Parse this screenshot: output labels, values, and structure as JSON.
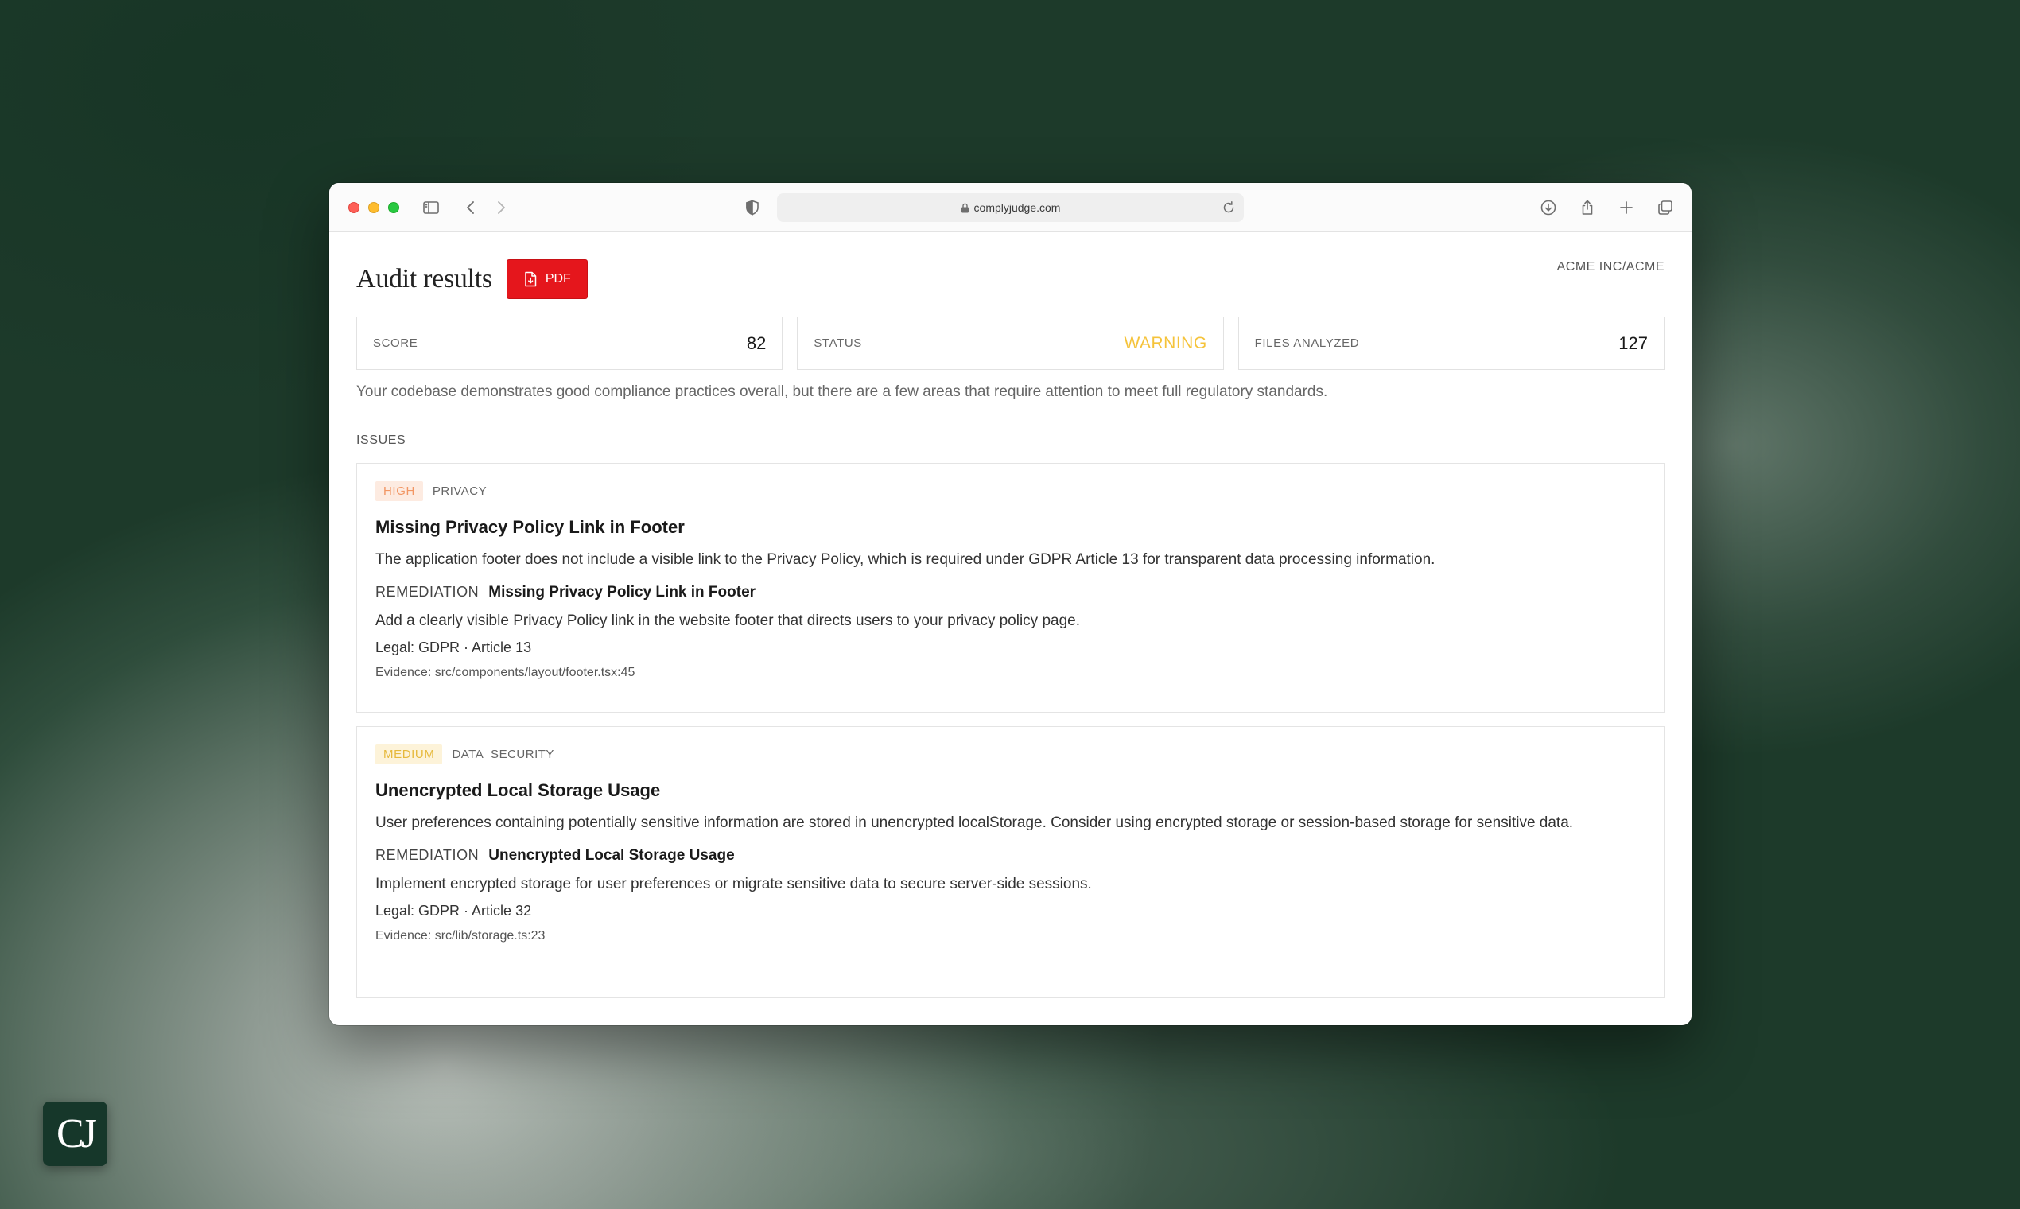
{
  "browser": {
    "url": "complyjudge.com"
  },
  "header": {
    "title": "Audit results",
    "pdf_label": "PDF",
    "org": "ACME INC/ACME"
  },
  "stats": [
    {
      "label": "SCORE",
      "value": "82"
    },
    {
      "label": "STATUS",
      "value": "WARNING"
    },
    {
      "label": "FILES ANALYZED",
      "value": "127"
    }
  ],
  "summary": "Your codebase demonstrates good compliance practices overall, but there are a few areas that require attention to meet full regulatory standards.",
  "issues_label": "ISSUES",
  "issues": [
    {
      "severity": "HIGH",
      "category": "PRIVACY",
      "title": "Missing Privacy Policy Link in Footer",
      "description": "The application footer does not include a visible link to the Privacy Policy, which is required under GDPR Article 13 for transparent data processing information.",
      "remediation_label": "REMEDIATION",
      "remediation_title": "Missing Privacy Policy Link in Footer",
      "remediation_desc": "Add a clearly visible Privacy Policy link in the website footer that directs users to your privacy policy page.",
      "legal": "Legal: GDPR · Article 13",
      "evidence": "Evidence: src/components/layout/footer.tsx:45"
    },
    {
      "severity": "MEDIUM",
      "category": "DATA_SECURITY",
      "title": "Unencrypted Local Storage Usage",
      "description": "User preferences containing potentially sensitive information are stored in unencrypted localStorage. Consider using encrypted storage or session-based storage for sensitive data.",
      "remediation_label": "REMEDIATION",
      "remediation_title": "Unencrypted Local Storage Usage",
      "remediation_desc": "Implement encrypted storage for user preferences or migrate sensitive data to secure server-side sessions.",
      "legal": "Legal: GDPR · Article 32",
      "evidence": "Evidence: src/lib/storage.ts:23"
    }
  ],
  "logo": {
    "text": "CJ"
  },
  "colors": {
    "pdf_button": "#e5161c",
    "warning": "#f5c33b",
    "high_badge_bg": "#fdebe1",
    "high_badge_text": "#f29663",
    "medium_badge_bg": "#fdf3d9",
    "medium_badge_text": "#e6b93c",
    "logo_bg": "#16372a"
  },
  "icons": [
    "sidebar-icon",
    "back-icon",
    "forward-icon",
    "shield-icon",
    "lock-icon",
    "reload-icon",
    "download-icon",
    "share-icon",
    "new-tab-icon",
    "tabs-overview-icon",
    "pdf-file-icon"
  ]
}
